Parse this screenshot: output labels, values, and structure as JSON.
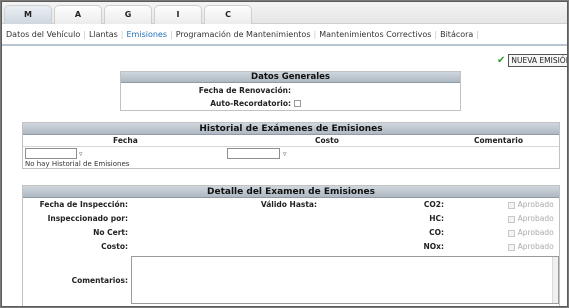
{
  "tabs": [
    {
      "label": "M",
      "active": true
    },
    {
      "label": "A",
      "active": false
    },
    {
      "label": "G",
      "active": false
    },
    {
      "label": "I",
      "active": false
    },
    {
      "label": "C",
      "active": false
    }
  ],
  "nav": {
    "items": [
      "Datos del Vehículo",
      "Llantas",
      "Emisiones",
      "Programación de Mantenimientos",
      "Mantenimientos Correctivos",
      "Bitácora"
    ],
    "active": "Emisiones",
    "separator": "|"
  },
  "new_button": {
    "icon": "check-icon",
    "label": "NUEVA EMISIÓN"
  },
  "datos_generales": {
    "title": "Datos Generales",
    "fecha_renovacion_label": "Fecha de Renovación:",
    "auto_recordatorio_label": "Auto-Recordatorio:"
  },
  "historial": {
    "title": "Historial de Exámenes de Emisiones",
    "columns": [
      "Fecha",
      "Costo",
      "Comentario"
    ],
    "filter_icon": "funnel-icon",
    "empty_text": "No hay Historial de Emisiones"
  },
  "detalle": {
    "title": "Detalle del Examen de Emisiones",
    "fecha_inspeccion_label": "Fecha de Inspección:",
    "valido_hasta_label": "Válido Hasta:",
    "inspeccionado_por_label": "Inspeccionado por:",
    "no_cert_label": "No Cert:",
    "costo_label": "Costo:",
    "comentarios_label": "Comentarios:",
    "gases": [
      {
        "label": "CO2:",
        "status": "Aprobado"
      },
      {
        "label": "HC:",
        "status": "Aprobado"
      },
      {
        "label": "CO:",
        "status": "Aprobado"
      },
      {
        "label": "NOx:",
        "status": "Aprobado"
      }
    ]
  }
}
